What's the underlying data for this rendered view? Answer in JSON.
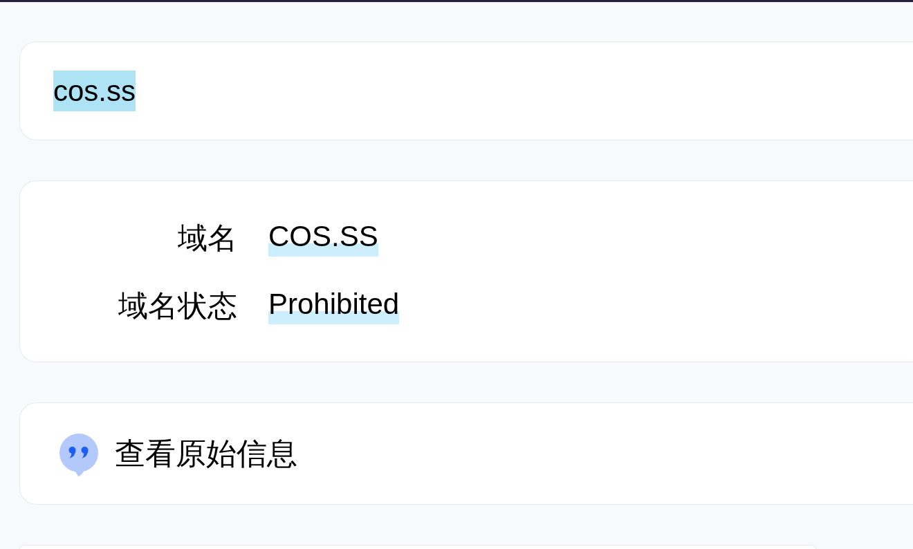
{
  "search": {
    "value": "cos.ss",
    "text_selected": true
  },
  "domain_info": {
    "fields": [
      {
        "label": "域名",
        "value": "COS.SS",
        "highlighted": true
      },
      {
        "label": "域名状态",
        "value": "Prohibited",
        "highlighted": true
      }
    ]
  },
  "raw_info": {
    "label": "查看原始信息"
  }
}
